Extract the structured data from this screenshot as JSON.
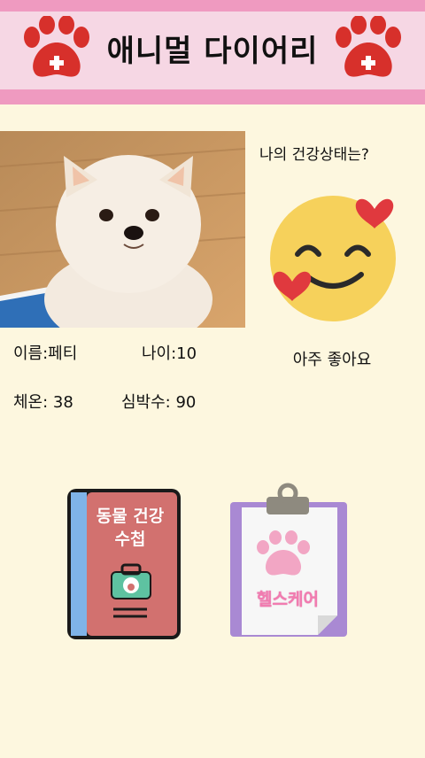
{
  "header": {
    "title": "애니멀 다이어리",
    "colors": {
      "bar": "#ef9ac0",
      "band": "#f6d7e4",
      "paw": "#d7302b"
    }
  },
  "pet": {
    "name_label": "이름:페티",
    "age_label": "나이:10",
    "temperature_label": "체온: 38",
    "heart_rate_label": "심박수: 90"
  },
  "health": {
    "question": "나의 건강상태는?",
    "status": "아주 좋아요",
    "emoji_icon": "smiling-face-with-hearts-icon"
  },
  "menu": {
    "handbook_label_line1": "동물 건강",
    "handbook_label_line2": "수첩",
    "healthcare_label": "헬스케어"
  }
}
